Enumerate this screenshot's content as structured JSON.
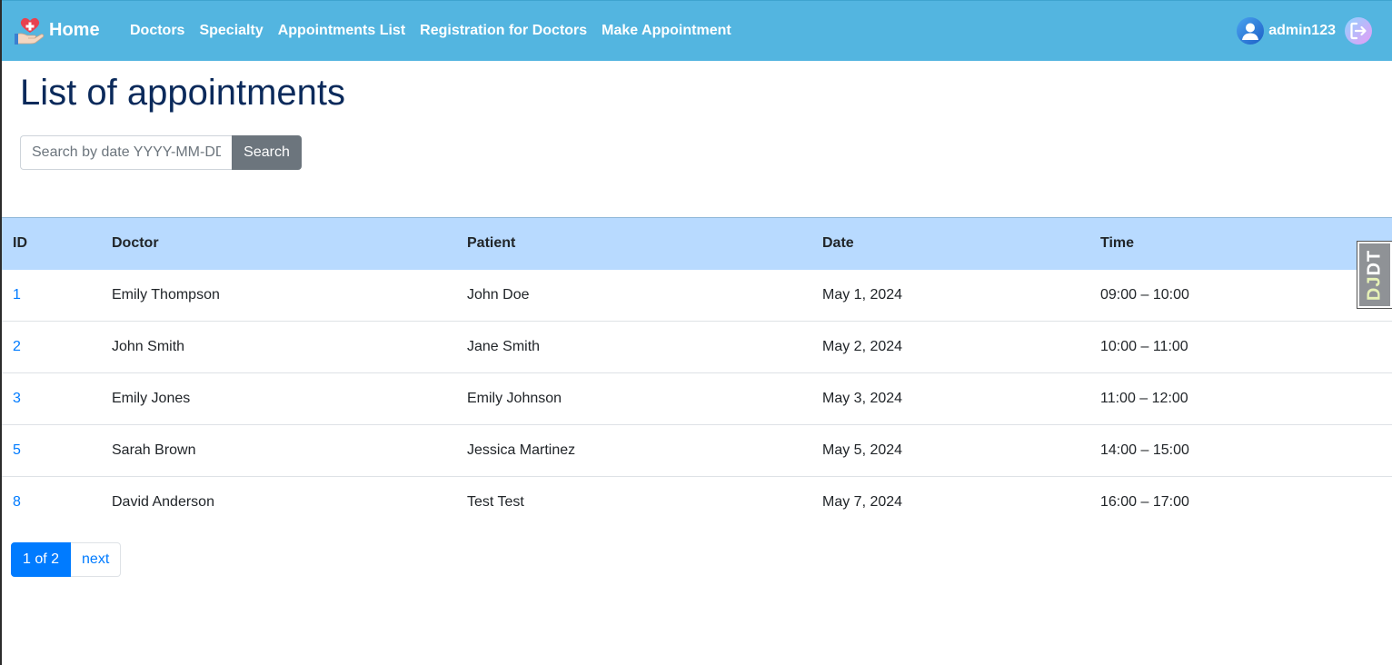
{
  "navbar": {
    "brand_label": "Home",
    "links": [
      "Doctors",
      "Specialty",
      "Appointments List",
      "Registration for Doctors",
      "Make Appointment"
    ],
    "username": "admin123",
    "accent_color": "#53b5e0"
  },
  "page": {
    "title": "List of appointments"
  },
  "search": {
    "placeholder": "Search by date YYYY-MM-DD",
    "value": "",
    "button_label": "Search"
  },
  "table": {
    "headers": [
      "ID",
      "Doctor",
      "Patient",
      "Date",
      "Time"
    ],
    "rows": [
      {
        "id": "1",
        "doctor": "Emily Thompson",
        "patient": "John Doe",
        "date": "May 1, 2024",
        "time": "09:00 – 10:00"
      },
      {
        "id": "2",
        "doctor": "John Smith",
        "patient": "Jane Smith",
        "date": "May 2, 2024",
        "time": "10:00 – 11:00"
      },
      {
        "id": "3",
        "doctor": "Emily Jones",
        "patient": "Emily Johnson",
        "date": "May 3, 2024",
        "time": "11:00 – 12:00"
      },
      {
        "id": "5",
        "doctor": "Sarah Brown",
        "patient": "Jessica Martinez",
        "date": "May 5, 2024",
        "time": "14:00 – 15:00"
      },
      {
        "id": "8",
        "doctor": "David Anderson",
        "patient": "Test Test",
        "date": "May 7, 2024",
        "time": "16:00 – 17:00"
      }
    ]
  },
  "pagination": {
    "current_label": "1 of 2",
    "next_label": "next"
  },
  "debug_toolbar": {
    "prefix": "DJ",
    "suffix": "DT"
  }
}
